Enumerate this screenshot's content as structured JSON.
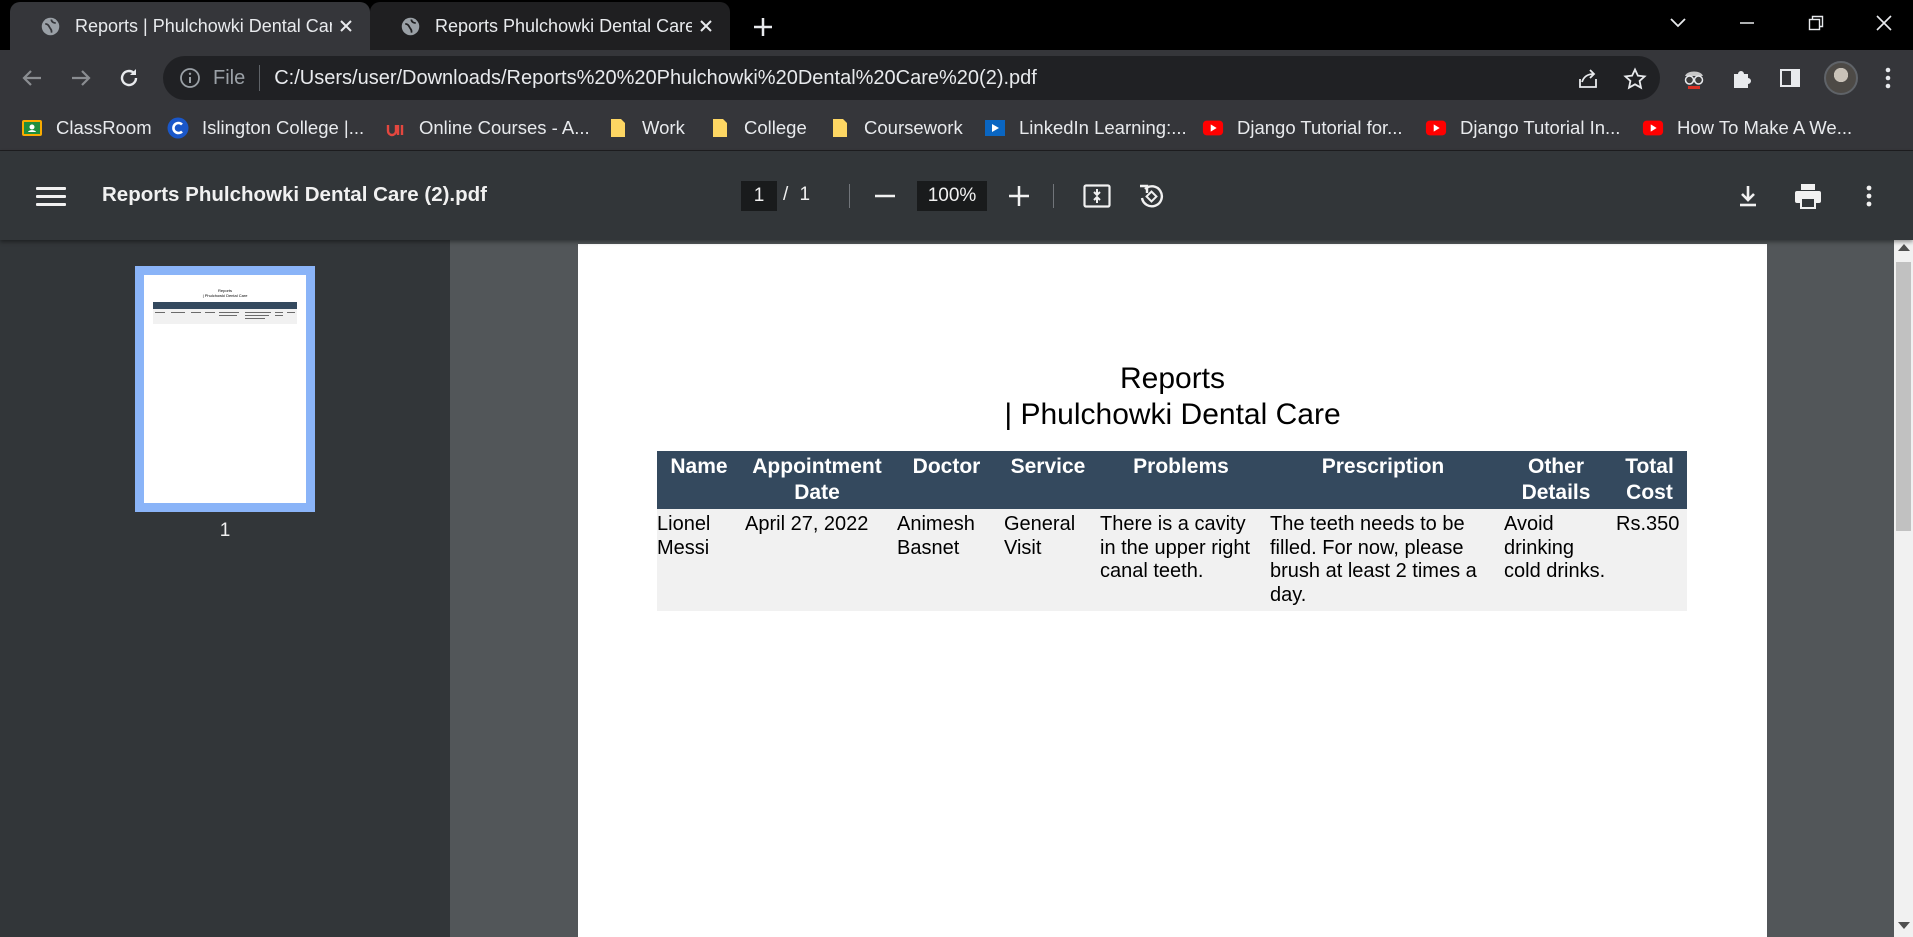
{
  "browser": {
    "tabs": [
      {
        "title": "Reports | Phulchowki Dental Care",
        "active": true
      },
      {
        "title": "Reports Phulchowki Dental Care (",
        "active": false
      }
    ],
    "address": {
      "scheme_label": "File",
      "url": "C:/Users/user/Downloads/Reports%20%20Phulchowki%20Dental%20Care%20(2).pdf"
    },
    "bookmarks": [
      {
        "label": "ClassRoom",
        "icon": "google-classroom-icon"
      },
      {
        "label": "Islington College |...",
        "icon": "college-c-icon"
      },
      {
        "label": "Online Courses - A...",
        "icon": "udemy-icon"
      },
      {
        "label": "Work",
        "icon": "folder-icon"
      },
      {
        "label": "College",
        "icon": "folder-icon"
      },
      {
        "label": "Coursework",
        "icon": "folder-icon"
      },
      {
        "label": "LinkedIn Learning:...",
        "icon": "linkedin-learning-icon"
      },
      {
        "label": "Django Tutorial for...",
        "icon": "youtube-icon"
      },
      {
        "label": "Django Tutorial In...",
        "icon": "youtube-icon"
      },
      {
        "label": "How To Make A We...",
        "icon": "youtube-icon"
      }
    ]
  },
  "viewer": {
    "file_title": "Reports Phulchowki Dental Care (2).pdf",
    "current_page": "1",
    "page_count": "/ 1",
    "zoom": "100%",
    "thumbnail_label": "1"
  },
  "report": {
    "title_line1": "Reports",
    "title_line2": "| Phulchowki Dental Care",
    "columns": [
      "Name",
      "Appointment Date",
      "Doctor",
      "Service",
      "Problems",
      "Prescription",
      "Other Details",
      "Total Cost"
    ],
    "rows": [
      {
        "name": "Lionel Messi",
        "appointment_date": "April 27, 2022",
        "doctor": "Animesh Basnet",
        "service": "General Visit",
        "problems": "There is a cavity in the upper right canal teeth.",
        "prescription": "The teeth needs to be filled. For now, please brush at least 2 times a day.",
        "other_details": "Avoid drinking cold drinks.",
        "total_cost": "Rs.350"
      }
    ]
  },
  "colors": {
    "table_header": "#34495e",
    "table_row": "#f1f1f1",
    "thumbnail_highlight": "#8ab4f8",
    "viewer_header": "#323639",
    "viewer_background": "#525659"
  }
}
